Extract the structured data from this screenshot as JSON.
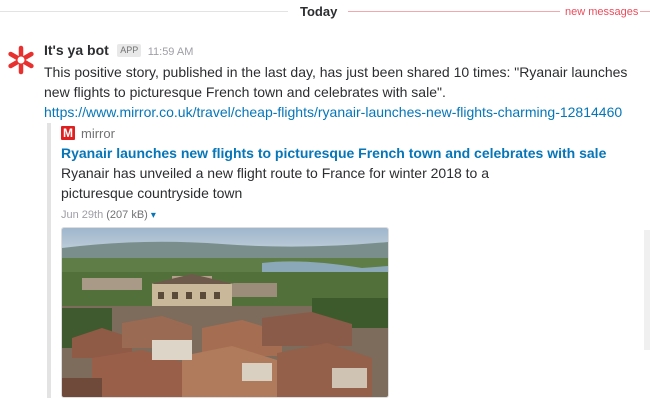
{
  "divider": {
    "label": "Today",
    "new_messages": "new messages"
  },
  "message": {
    "author": "It's ya bot",
    "badge": "APP",
    "time": "11:59 AM",
    "text": "This positive story, published in the last day, has just been shared 10 times:  \"Ryanair launches new flights to picturesque French town and celebrates with sale\".",
    "url": "https://www.mirror.co.uk/travel/cheap-flights/ryanair-launches-new-flights-charming-12814460"
  },
  "attachment": {
    "source_logo": "M",
    "source": "mirror",
    "title": "Ryanair launches new flights to picturesque French town and celebrates with sale",
    "description": "Ryanair has unveiled a new flight route to France for winter 2018 to a picturesque countryside town",
    "date": "Jun 29th",
    "size": "(207 kB)",
    "caret": "▾"
  },
  "colors": {
    "link": "#0576b9",
    "new_messages": "#eb4d5c",
    "logo": "#e02020",
    "avatar": "#e8302e"
  },
  "icons": {
    "avatar": "asterisk-bot-icon",
    "caret": "chevron-down-icon"
  }
}
